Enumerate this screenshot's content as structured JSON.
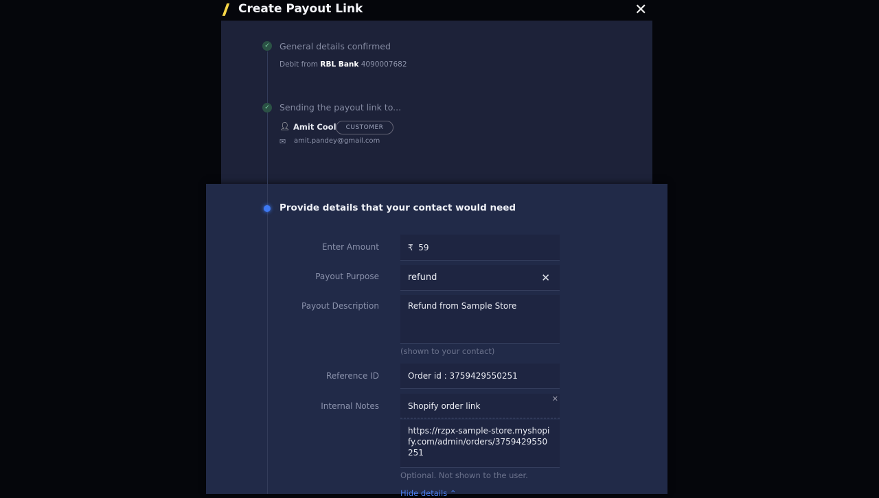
{
  "header": {
    "title": "Create Payout Link",
    "close_icon": "close-icon"
  },
  "steps": [
    {
      "title": "General details confirmed",
      "debit_prefix": "Debit from",
      "bank": "RBL Bank",
      "account": "4090007682"
    },
    {
      "title": "Sending the payout link to...",
      "contact_name": "Amit Cool",
      "contact_type": "CUSTOMER",
      "email": "amit.pandey@gmail.com"
    },
    {
      "title": "Provide details that your contact would need"
    }
  ],
  "form": {
    "amount_label": "Enter Amount",
    "currency": "₹",
    "amount": "59",
    "purpose_label": "Payout Purpose",
    "purpose": "refund",
    "description_label": "Payout Description",
    "description": "Refund from Sample Store",
    "description_hint": "(shown to your contact)",
    "reference_label": "Reference ID",
    "reference": "Order id : 3759429550251",
    "notes_label": "Internal Notes",
    "note_title": "Shopify order link",
    "note_body": "https://rzpx-sample-store.myshopify.com/admin/orders/3759429550251",
    "notes_hint": "Optional. Not shown to the user.",
    "hide_details": "Hide details ⌃"
  },
  "colors": {
    "accent": "#3e79f2",
    "logo": "#f5d547",
    "check": "#7fd3a4"
  }
}
